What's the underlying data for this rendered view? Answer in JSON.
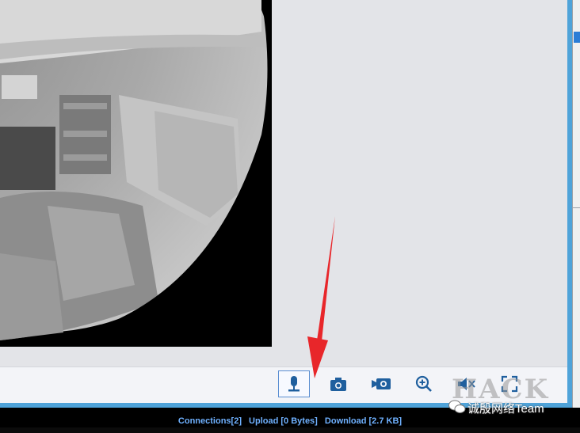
{
  "toolbar": {
    "buttons": [
      {
        "name": "microphone",
        "icon": "microphone-icon",
        "active": true
      },
      {
        "name": "snapshot",
        "icon": "camera-icon",
        "active": false
      },
      {
        "name": "record",
        "icon": "video-camera-icon",
        "active": false
      },
      {
        "name": "zoom",
        "icon": "zoom-in-icon",
        "active": false
      },
      {
        "name": "mute",
        "icon": "speaker-mute-icon",
        "active": false
      },
      {
        "name": "fullscreen",
        "icon": "fullscreen-icon",
        "active": false
      }
    ]
  },
  "status": {
    "connections": "Connections[2]",
    "upload": "Upload [0 Bytes]",
    "download": "Download [2.7 KB]"
  },
  "watermark": {
    "brand": "HACK",
    "caption": "诚殷网络Team"
  },
  "colors": {
    "accent": "#4fa3d9",
    "annotation_arrow": "#e8262a",
    "status_text": "#6fb1ff"
  }
}
